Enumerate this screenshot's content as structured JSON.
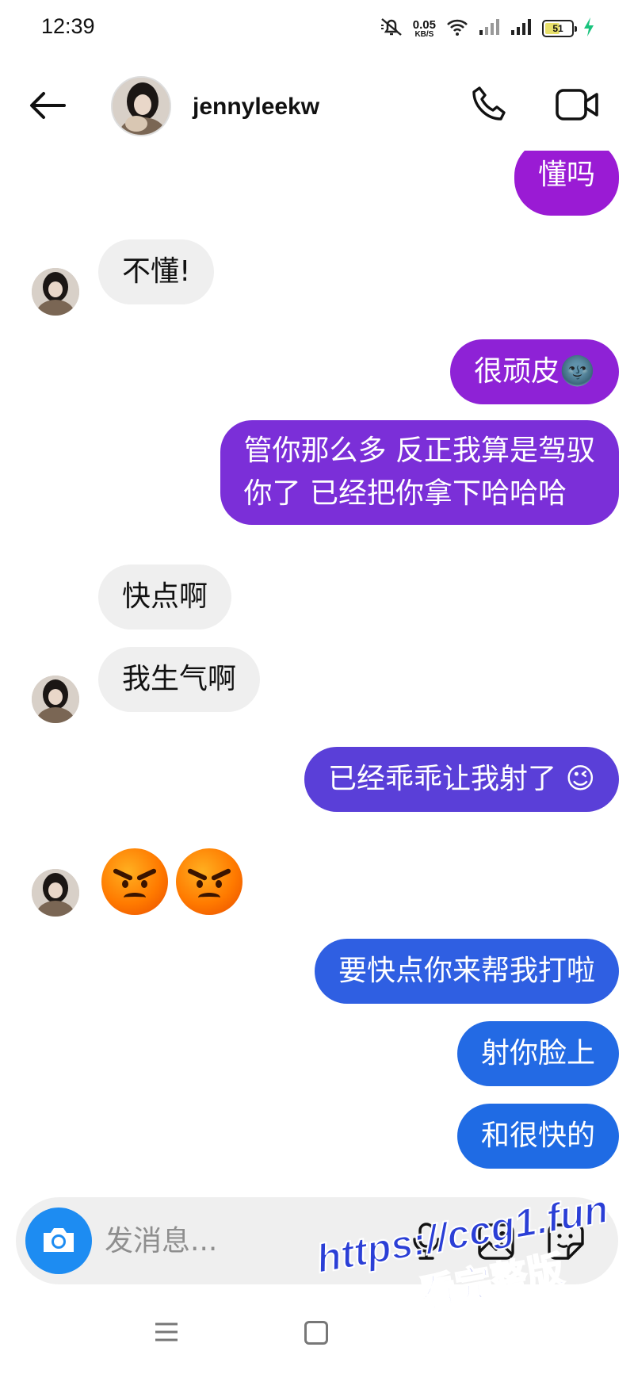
{
  "status_bar": {
    "time": "12:39",
    "net_speed_value": "0.05",
    "net_speed_unit": "KB/S",
    "battery_level": "51",
    "icons": [
      "mute-icon",
      "wifi-icon",
      "signal-icon",
      "signal-icon",
      "battery-icon",
      "charging-icon"
    ]
  },
  "header": {
    "contact_name": "jennyleekw",
    "icons": [
      "back-arrow-icon",
      "phone-icon",
      "video-camera-icon"
    ]
  },
  "messages": [
    {
      "side": "out",
      "text": "懂吗"
    },
    {
      "side": "in",
      "text": "不懂!"
    },
    {
      "side": "out",
      "text": "很顽皮🌚"
    },
    {
      "side": "out",
      "line1": "管你那么多 反正我算是驾驭",
      "line2": "你了 已经把你拿下哈哈哈"
    },
    {
      "side": "in",
      "text": "快点啊"
    },
    {
      "side": "in",
      "text": "我生气啊"
    },
    {
      "side": "out",
      "text": "已经乖乖让我射了 😉"
    },
    {
      "side": "in",
      "emoji": "😡😡"
    },
    {
      "side": "out",
      "text": "要快点你来帮我打啦"
    },
    {
      "side": "out",
      "text": "射你脸上"
    },
    {
      "side": "out",
      "text": "和很快的"
    }
  ],
  "colors": {
    "out_top": "#8f1fd6",
    "out_mid": "#5a3fd8",
    "out_bottom": "#1f6be4",
    "in_bubble": "#efefef",
    "camera_button": "#1d8cf2"
  },
  "composer": {
    "placeholder": "发消息...",
    "icons": [
      "camera-icon",
      "microphone-icon",
      "image-icon",
      "sticker-icon"
    ]
  },
  "nav": {
    "icons": [
      "menu-icon",
      "home-icon"
    ]
  },
  "watermark": {
    "url": "https://ccg1.fun",
    "subtitle": "看完整版"
  }
}
